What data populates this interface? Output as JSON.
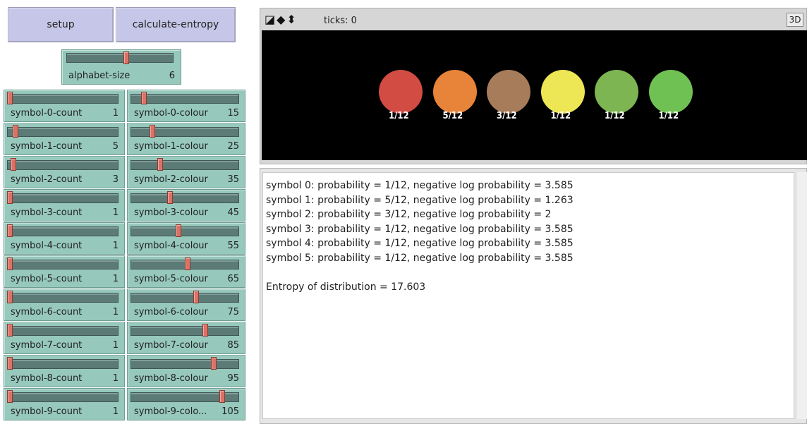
{
  "buttons": {
    "setup": "setup",
    "calculate": "calculate-entropy"
  },
  "alphabet_slider": {
    "label": "alphabet-size",
    "value": "6",
    "fraction": 0.55
  },
  "count_sliders": [
    {
      "label": "symbol-0-count",
      "value": "1",
      "fraction": 0.0
    },
    {
      "label": "symbol-1-count",
      "value": "5",
      "fraction": 0.05
    },
    {
      "label": "symbol-2-count",
      "value": "3",
      "fraction": 0.03
    },
    {
      "label": "symbol-3-count",
      "value": "1",
      "fraction": 0.0
    },
    {
      "label": "symbol-4-count",
      "value": "1",
      "fraction": 0.0
    },
    {
      "label": "symbol-5-count",
      "value": "1",
      "fraction": 0.0
    },
    {
      "label": "symbol-6-count",
      "value": "1",
      "fraction": 0.0
    },
    {
      "label": "symbol-7-count",
      "value": "1",
      "fraction": 0.0
    },
    {
      "label": "symbol-8-count",
      "value": "1",
      "fraction": 0.0
    },
    {
      "label": "symbol-9-count",
      "value": "1",
      "fraction": 0.0
    }
  ],
  "colour_sliders": [
    {
      "label": "symbol-0-colour",
      "value": "15",
      "fraction": 0.1
    },
    {
      "label": "symbol-1-colour",
      "value": "25",
      "fraction": 0.18
    },
    {
      "label": "symbol-2-colour",
      "value": "35",
      "fraction": 0.26
    },
    {
      "label": "symbol-3-colour",
      "value": "45",
      "fraction": 0.35
    },
    {
      "label": "symbol-4-colour",
      "value": "55",
      "fraction": 0.43
    },
    {
      "label": "symbol-5-colour",
      "value": "65",
      "fraction": 0.52
    },
    {
      "label": "symbol-6-colour",
      "value": "75",
      "fraction": 0.6
    },
    {
      "label": "symbol-7-colour",
      "value": "85",
      "fraction": 0.69
    },
    {
      "label": "symbol-8-colour",
      "value": "95",
      "fraction": 0.77
    },
    {
      "label": "symbol-9-colour",
      "value": "105",
      "display_label": "symbol-9-colo...",
      "fraction": 0.85
    }
  ],
  "view": {
    "ticks_label": "ticks: 0",
    "btn_3d": "3D",
    "tool_icons": "◪◆⬍",
    "symbols": [
      {
        "label": "1/12",
        "color": "#d24c43"
      },
      {
        "label": "5/12",
        "color": "#e8843a"
      },
      {
        "label": "3/12",
        "color": "#a67c5b"
      },
      {
        "label": "1/12",
        "color": "#ede655"
      },
      {
        "label": "1/12",
        "color": "#7db552"
      },
      {
        "label": "1/12",
        "color": "#6fc154"
      }
    ]
  },
  "output": {
    "lines": [
      "symbol 0: probability = 1/12, negative log probability = 3.585",
      "symbol 1: probability = 5/12, negative log probability = 1.263",
      "symbol 2: probability = 3/12, negative log probability = 2",
      "symbol 3: probability = 1/12, negative log probability = 3.585",
      "symbol 4: probability = 1/12, negative log probability = 3.585",
      "symbol 5: probability = 1/12, negative log probability = 3.585",
      "",
      "Entropy of distribution = 17.603"
    ]
  }
}
